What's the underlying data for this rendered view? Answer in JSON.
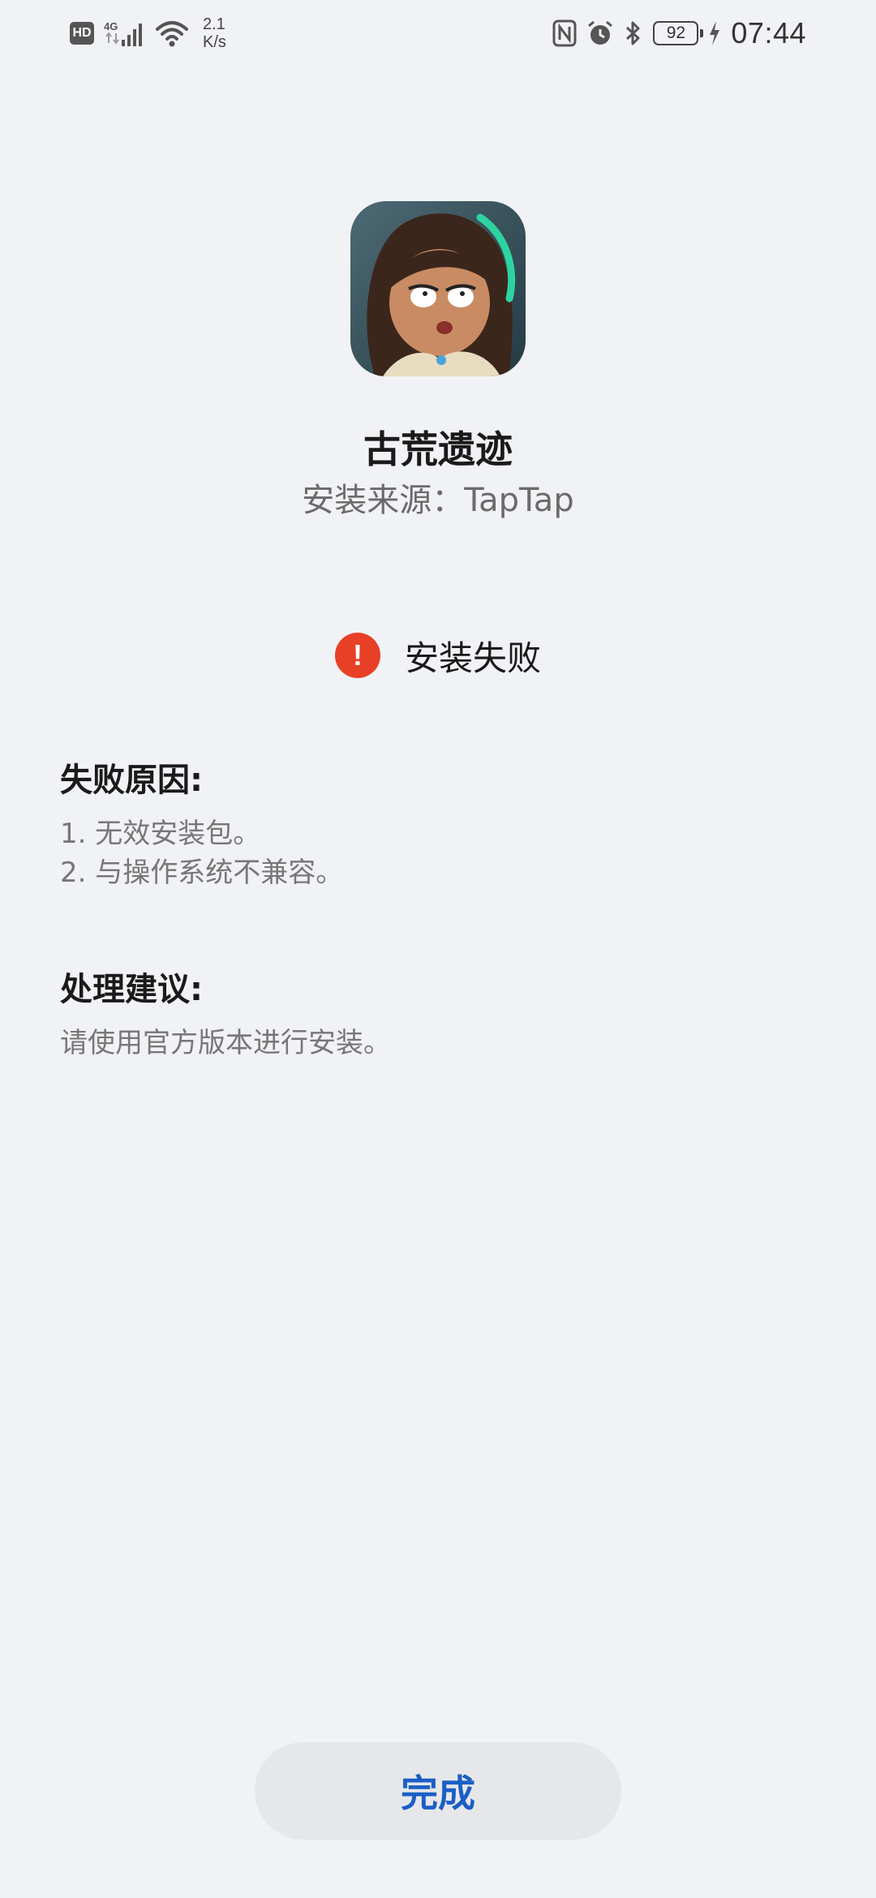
{
  "status_bar": {
    "hd_label": "HD",
    "network_type": "4G",
    "speed_value": "2.1",
    "speed_unit": "K/s",
    "battery_level": "92",
    "time": "07:44",
    "icons": [
      "hd-icon",
      "signal-icon",
      "wifi-icon",
      "nfc-icon",
      "alarm-icon",
      "bluetooth-icon",
      "battery-icon",
      "charging-icon"
    ]
  },
  "app": {
    "name": "古荒遗迹",
    "install_source": "安装来源：TapTap"
  },
  "status": {
    "text": "安装失败",
    "icon_glyph": "!",
    "color": "#e84026"
  },
  "reasons": {
    "title": "失败原因:",
    "items": [
      "1. 无效安装包。",
      "2. 与操作系统不兼容。"
    ]
  },
  "advice": {
    "title": "处理建议:",
    "text": "请使用官方版本进行安装。"
  },
  "done_button": {
    "label": "完成",
    "color": "#1a5fc6"
  }
}
